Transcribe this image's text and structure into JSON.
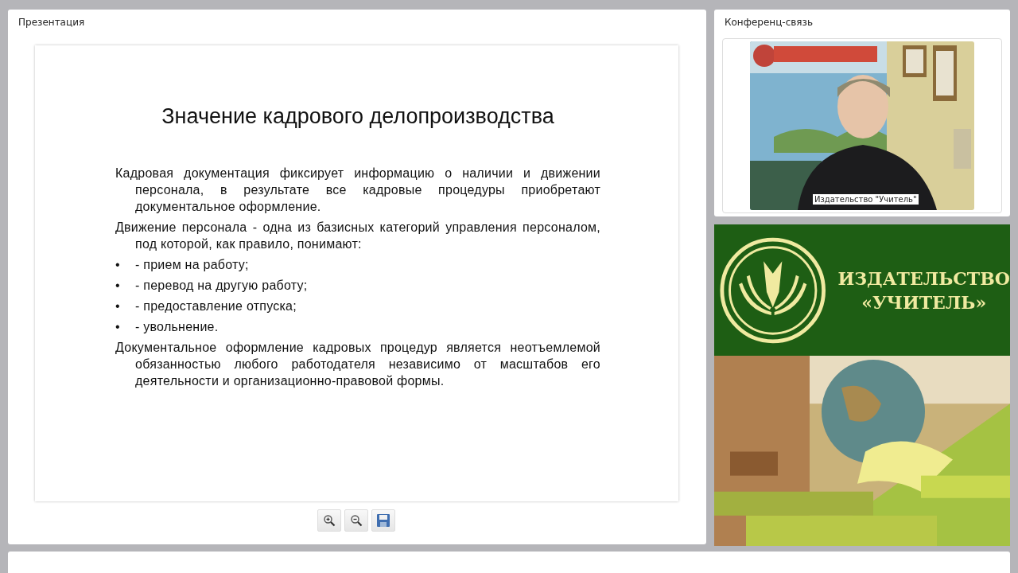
{
  "presentation": {
    "title": "Презентация",
    "slide": {
      "heading": "Значение кадрового делопроизводства",
      "blocks": [
        {
          "kind": "paragraph",
          "text": "Кадровая документация фиксирует информацию о наличии и движении персонала, в результате все кадровые процедуры приобретают документальное оформление."
        },
        {
          "kind": "paragraph",
          "text": "Движение персонала - одна из базисных категорий управления персоналом, под которой, как правило, понимают:"
        },
        {
          "kind": "bullet",
          "marker": "•",
          "text": "- прием на работу;"
        },
        {
          "kind": "bullet",
          "marker": "•",
          "text": "- перевод на другую работу;"
        },
        {
          "kind": "bullet",
          "marker": "•",
          "text": "- предоставление отпуска;"
        },
        {
          "kind": "bullet",
          "marker": "•",
          "text": "- увольнение."
        },
        {
          "kind": "paragraph",
          "text": "Документальное оформление кадровых процедур является неотъемлемой обязанностью любого работодателя независимо от масштабов его деятельности и организационно-правовой формы."
        }
      ]
    },
    "toolbar": [
      {
        "kind": "zoom-in"
      },
      {
        "kind": "zoom-out"
      },
      {
        "kind": "save"
      }
    ]
  },
  "conference": {
    "title": "Конференц-связь",
    "video": {
      "kind": "picture",
      "caption": "Издательство \"Учитель\""
    }
  },
  "banner": {
    "lines": [
      "ИЗДАТЕЛЬСТВО",
      "«УЧИТЕЛЬ»"
    ],
    "photo": {
      "kind": "picture"
    }
  }
}
